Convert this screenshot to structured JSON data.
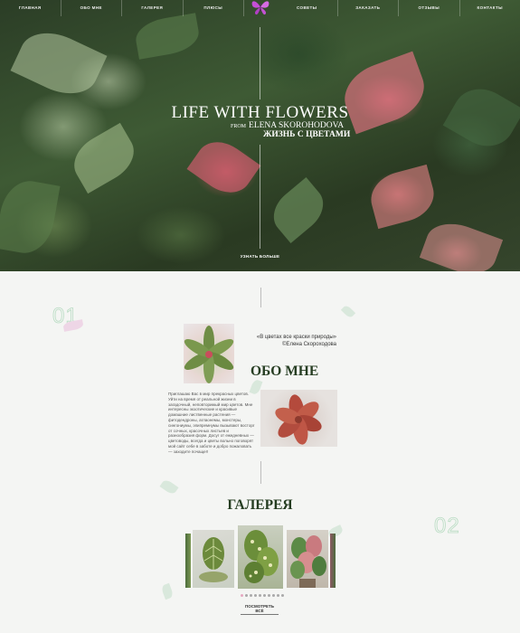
{
  "nav": {
    "items_left": [
      {
        "label": "ГЛАВНАЯ"
      },
      {
        "label": "ОБО МНЕ"
      },
      {
        "label": "ГАЛЕРЕЯ"
      },
      {
        "label": "ПЛЮСЫ"
      }
    ],
    "items_right": [
      {
        "label": "СОВЕТЫ"
      },
      {
        "label": "ЗАКАЗАТЬ"
      },
      {
        "label": "ОТЗЫВЫ"
      },
      {
        "label": "КОНТАКТЫ"
      }
    ]
  },
  "hero": {
    "title": "LIFE WITH FLOWERS",
    "from": "FROM",
    "author": "ELENA SKOROHODOVA",
    "subtitle": "ЖИЗНЬ С ЦВЕТАМИ",
    "more_link": "УЗНАТЬ БОЛЬШЕ"
  },
  "about": {
    "number": "01",
    "quote": "«В цветах все краски природы»",
    "quote_author": "©Елена Скороходова",
    "heading": "ОБО МНЕ",
    "text": "Приглашаю Вас в мир прекрасных цветов. Уйти на время от реальной жизни в загадочный, неповторимый мир цветов. Мне интересны экзотические и красивые домашние лиственные растения — фитодендроны, аглаонемы, монстеры, сингониумы, эпипремнумы вызывают восторг от сочных, красочных листьев и разнообразия форм. Досуг от ежедневных — цветоводы, всегда и цветы вольно поговорят мой сайт себе в заботе и добро пожаловать — заходите почаще!!"
  },
  "gallery": {
    "number": "02",
    "heading": "ГАЛЕРЕЯ",
    "dot_count": 10,
    "active_dot": 0,
    "button_label": "ПОСМОТРЕТЬ ВСЁ"
  },
  "colors": {
    "accent_pink": "#e6a8c0",
    "heading_green": "#263d22",
    "number_green": "#b9dcc3",
    "logo_purple": "#c54fd6"
  },
  "icons": {
    "logo": "butterfly-icon"
  }
}
